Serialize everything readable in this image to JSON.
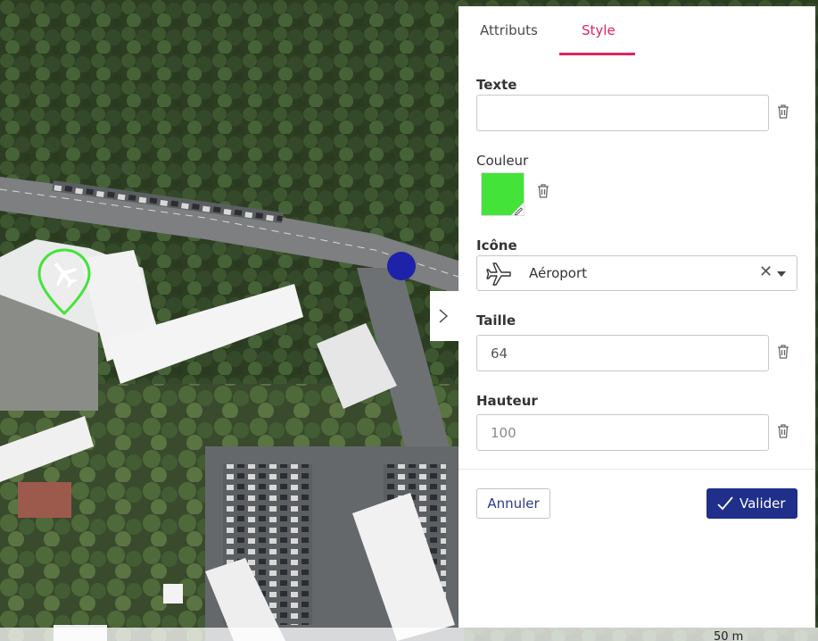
{
  "map": {
    "scale_label": "50 m",
    "marker_color": "#44e33a",
    "marker_icon": "airplane-icon",
    "point_color": "#1e22a8"
  },
  "panel": {
    "tabs": [
      {
        "label": "Attributs",
        "active": false
      },
      {
        "label": "Style",
        "active": true
      }
    ],
    "accent_color": "#e0245e",
    "texte": {
      "label": "Texte",
      "value": ""
    },
    "couleur": {
      "label": "Couleur",
      "value": "#44e33a"
    },
    "icone": {
      "label": "Icône",
      "value": "Aéroport",
      "icon": "airplane-icon"
    },
    "taille": {
      "label": "Taille",
      "value": "64"
    },
    "hauteur": {
      "label": "Hauteur",
      "placeholder": "100"
    },
    "buttons": {
      "cancel": "Annuler",
      "ok": "Valider"
    },
    "primary_color": "#1f2f8a"
  }
}
